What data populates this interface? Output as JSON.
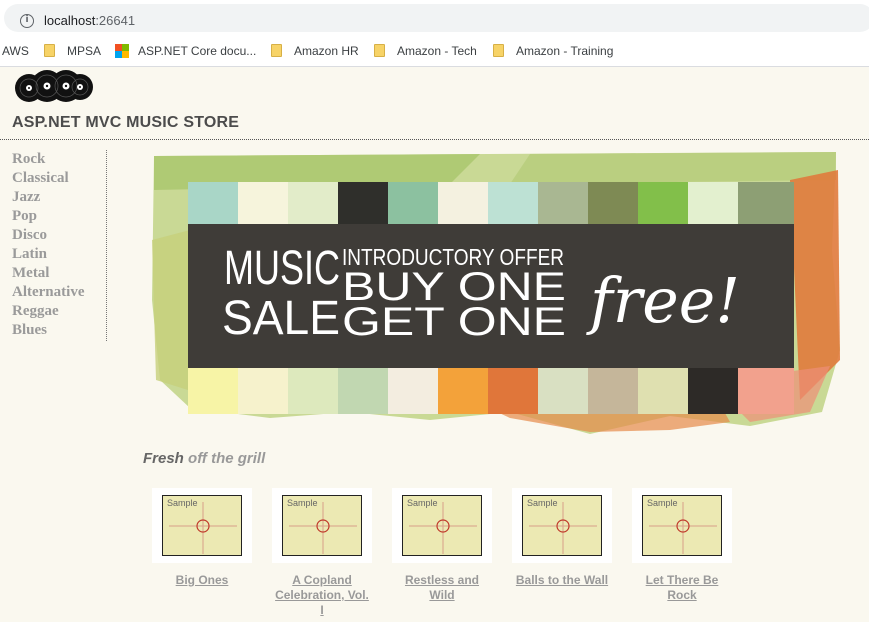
{
  "browser": {
    "url_host": "localhost",
    "url_port": ":26641",
    "info_icon": "i",
    "bookmarks": [
      {
        "label": "AWS",
        "icon": "none"
      },
      {
        "label": "MPSA",
        "icon": "folder-icon"
      },
      {
        "label": "ASP.NET Core docu...",
        "icon": "microsoft-icon"
      },
      {
        "label": "Amazon HR",
        "icon": "folder-icon"
      },
      {
        "label": "Amazon - Tech",
        "icon": "folder-icon"
      },
      {
        "label": "Amazon - Training",
        "icon": "folder-icon"
      }
    ]
  },
  "site": {
    "title": "ASP.NET MVC MUSIC STORE",
    "logo_icon": "vinyl-records-icon"
  },
  "genres": [
    "Rock",
    "Classical",
    "Jazz",
    "Pop",
    "Disco",
    "Latin",
    "Metal",
    "Alternative",
    "Reggae",
    "Blues"
  ],
  "banner": {
    "music": "MUSIC",
    "sale": "SALE",
    "offer": "INTRODUCTORY OFFER",
    "buy": "BUY ONE",
    "get": "GET ONE",
    "free": "free!"
  },
  "fresh": {
    "bold": "Fresh",
    "light": "off the grill"
  },
  "albums": [
    {
      "title": "Big Ones",
      "sample": "Sample"
    },
    {
      "title": "A Copland Celebration, Vol. I",
      "sample": "Sample"
    },
    {
      "title": "Restless and Wild",
      "sample": "Sample"
    },
    {
      "title": "Balls to the Wall",
      "sample": "Sample"
    },
    {
      "title": "Let There Be Rock",
      "sample": "Sample"
    }
  ],
  "colors": {
    "ms_red": "#f25022",
    "ms_green": "#7fba00",
    "ms_blue": "#00a4ef",
    "ms_yellow": "#ffb900",
    "banner_dark": "#3f3c38"
  }
}
